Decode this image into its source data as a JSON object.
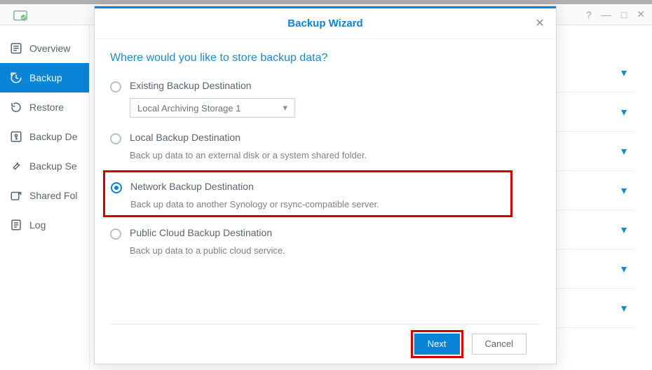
{
  "window": {
    "controls": [
      "minimize",
      "maximize",
      "close"
    ]
  },
  "sidebar": {
    "items": [
      {
        "label": "Overview"
      },
      {
        "label": "Backup"
      },
      {
        "label": "Restore"
      },
      {
        "label": "Backup De"
      },
      {
        "label": "Backup Se"
      },
      {
        "label": "Shared Fol"
      },
      {
        "label": "Log"
      }
    ],
    "activeIndex": 1
  },
  "modal": {
    "title": "Backup Wizard",
    "question": "Where would you like to store backup data?",
    "options": [
      {
        "label": "Existing Backup Destination",
        "dropdown": "Local Archiving Storage 1"
      },
      {
        "label": "Local Backup Destination",
        "desc": "Back up data to an external disk or a system shared folder."
      },
      {
        "label": "Network Backup Destination",
        "desc": "Back up data to another Synology or rsync-compatible server."
      },
      {
        "label": "Public Cloud Backup Destination",
        "desc": "Back up data to a public cloud service."
      }
    ],
    "selectedIndex": 2,
    "buttons": {
      "next": "Next",
      "cancel": "Cancel"
    }
  }
}
